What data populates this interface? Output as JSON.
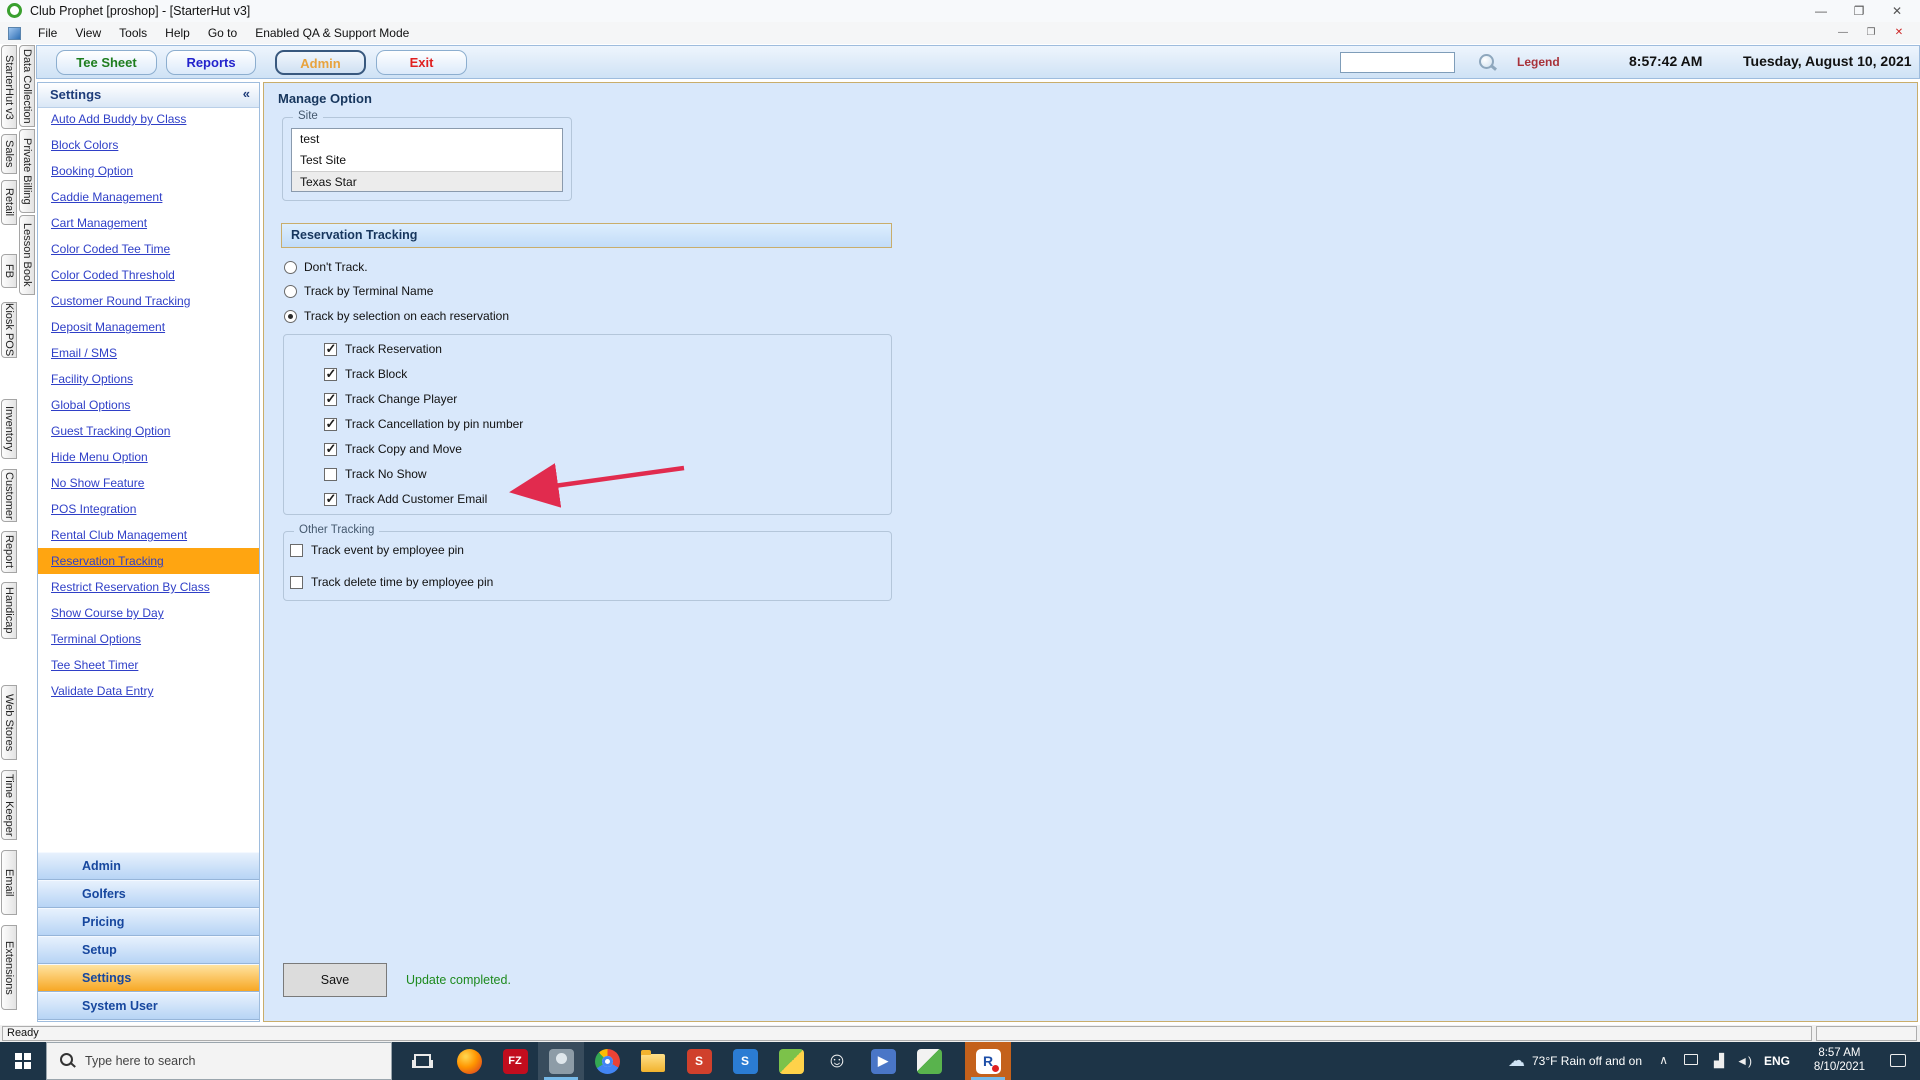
{
  "window": {
    "title": "Club Prophet [proshop] - [StarterHut v3]",
    "controls": {
      "minimize": "—",
      "maximize": "❐",
      "close": "✕"
    }
  },
  "menu": {
    "items": [
      "File",
      "View",
      "Tools",
      "Help",
      "Go to",
      "Enabled QA & Support Mode"
    ],
    "child_controls": {
      "minimize": "—",
      "restore": "❐",
      "close": "✕"
    }
  },
  "toolbar": {
    "buttons": [
      {
        "label": "Tee Sheet",
        "color": "#1e7d1e",
        "active": false
      },
      {
        "label": "Reports",
        "color": "#2323cc",
        "active": false
      },
      {
        "label": "Admin",
        "color": "#e8a33d",
        "active": true
      },
      {
        "label": "Exit",
        "color": "#e02020",
        "active": false
      }
    ],
    "search_value": "",
    "legend_label": "Legend",
    "clock": "8:57:42 AM",
    "date": "Tuesday, August 10, 2021"
  },
  "left_tabs": {
    "outer": [
      "StarterHut v3",
      "Sales",
      "Retail",
      "FB",
      "Kiosk POS",
      "Inventory",
      "Customer",
      "Report",
      "Handicap",
      "Web Stores",
      "Time Keeper",
      "Email",
      "Extensions"
    ],
    "inner": [
      "Data Collection",
      "Private Billing",
      "Lesson Book"
    ]
  },
  "sidebar": {
    "title": "Settings",
    "collapse_glyph": "«",
    "links": [
      {
        "label": "Auto Add Buddy by Class",
        "selected": false
      },
      {
        "label": "Block Colors",
        "selected": false
      },
      {
        "label": "Booking Option",
        "selected": false
      },
      {
        "label": "Caddie Management",
        "selected": false
      },
      {
        "label": "Cart Management",
        "selected": false
      },
      {
        "label": "Color Coded Tee Time",
        "selected": false
      },
      {
        "label": "Color Coded Threshold",
        "selected": false
      },
      {
        "label": "Customer Round Tracking",
        "selected": false
      },
      {
        "label": "Deposit Management",
        "selected": false
      },
      {
        "label": "Email / SMS",
        "selected": false
      },
      {
        "label": "Facility Options",
        "selected": false
      },
      {
        "label": "Global Options",
        "selected": false
      },
      {
        "label": "Guest Tracking Option",
        "selected": false
      },
      {
        "label": "Hide Menu Option",
        "selected": false
      },
      {
        "label": "No Show Feature",
        "selected": false
      },
      {
        "label": "POS Integration",
        "selected": false
      },
      {
        "label": "Rental Club Management",
        "selected": false
      },
      {
        "label": "Reservation Tracking",
        "selected": true
      },
      {
        "label": "Restrict Reservation By Class",
        "selected": false
      },
      {
        "label": "Show Course by Day",
        "selected": false
      },
      {
        "label": "Terminal Options",
        "selected": false
      },
      {
        "label": "Tee Sheet Timer",
        "selected": false
      },
      {
        "label": "Validate Data Entry",
        "selected": false
      }
    ],
    "sections": [
      {
        "label": "Admin",
        "selected": false
      },
      {
        "label": "Golfers",
        "selected": false
      },
      {
        "label": "Pricing",
        "selected": false
      },
      {
        "label": "Setup",
        "selected": false
      },
      {
        "label": "Settings",
        "selected": true
      },
      {
        "label": "System User",
        "selected": false
      }
    ]
  },
  "main": {
    "title": "Manage Option",
    "site": {
      "label": "Site",
      "options": [
        {
          "label": "test",
          "selected": false
        },
        {
          "label": "Test Site",
          "selected": false
        },
        {
          "label": "Texas Star",
          "selected": true
        }
      ]
    },
    "tracking": {
      "header": "Reservation Tracking",
      "radios": [
        {
          "label": "Don't Track.",
          "selected": false
        },
        {
          "label": "Track by Terminal Name",
          "selected": false
        },
        {
          "label": "Track by selection on each reservation",
          "selected": true
        }
      ],
      "checkboxes": [
        {
          "label": "Track Reservation",
          "checked": true
        },
        {
          "label": "Track Block",
          "checked": true
        },
        {
          "label": "Track Change Player",
          "checked": true
        },
        {
          "label": "Track Cancellation by pin number",
          "checked": true
        },
        {
          "label": "Track Copy and Move",
          "checked": true
        },
        {
          "label": "Track No Show",
          "checked": false
        },
        {
          "label": "Track Add Customer Email",
          "checked": true
        }
      ]
    },
    "other_tracking": {
      "label": "Other Tracking",
      "checkboxes": [
        {
          "label": "Track event by employee pin",
          "checked": false
        },
        {
          "label": "Track delete time by employee pin",
          "checked": false
        }
      ]
    },
    "save_label": "Save",
    "status_message": "Update completed.",
    "status_color": "#1e8a1e",
    "arrow_color": "#e12b4e"
  },
  "status_bar": {
    "text": "Ready"
  },
  "taskbar": {
    "search_placeholder": "Type here to search",
    "apps": [
      {
        "name": "firefox",
        "glyph": ""
      },
      {
        "name": "filezilla",
        "glyph": "FZ"
      },
      {
        "name": "launcher-app",
        "glyph": ""
      },
      {
        "name": "chrome",
        "glyph": ""
      },
      {
        "name": "file-explorer",
        "glyph": ""
      },
      {
        "name": "red-s-app",
        "glyph": "S"
      },
      {
        "name": "blue-s-app",
        "glyph": "S"
      },
      {
        "name": "green-app",
        "glyph": ""
      },
      {
        "name": "emoji-app",
        "glyph": "☺"
      },
      {
        "name": "media-app",
        "glyph": "▶"
      },
      {
        "name": "paint-app",
        "glyph": ""
      },
      {
        "name": "club-prophet",
        "glyph": "R"
      }
    ],
    "tray": {
      "weather_icon": "☁",
      "weather_text": "73°F  Rain off and on",
      "caret": "∧",
      "net_glyph": "▟",
      "vol_glyph": "◄)",
      "lang": "ENG",
      "time": "8:57 AM",
      "date": "8/10/2021"
    }
  }
}
